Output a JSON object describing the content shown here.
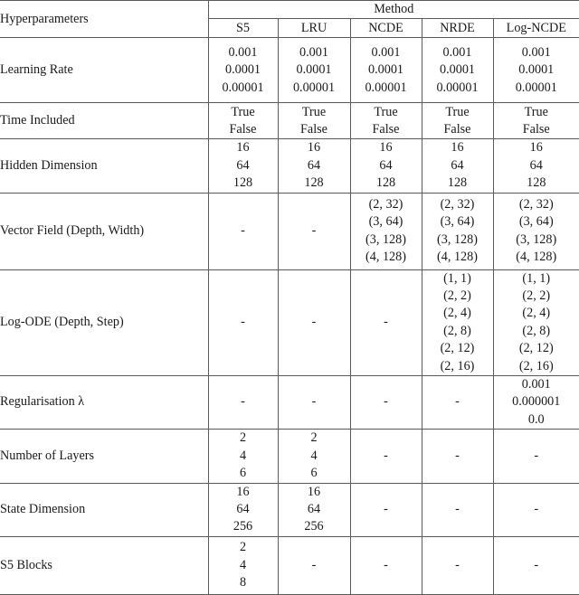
{
  "table": {
    "corner_label": "Hyperparameters",
    "group_header": "Method",
    "columns": [
      "S5",
      "LRU",
      "NCDE",
      "NRDE",
      "Log-NCDE"
    ],
    "dash": "-",
    "rows": [
      {
        "label": "Learning Rate",
        "cells": [
          [
            "0.001",
            "0.0001",
            "0.00001"
          ],
          [
            "0.001",
            "0.0001",
            "0.00001"
          ],
          [
            "0.001",
            "0.0001",
            "0.00001"
          ],
          [
            "0.001",
            "0.0001",
            "0.00001"
          ],
          [
            "0.001",
            "0.0001",
            "0.00001"
          ]
        ]
      },
      {
        "label": "Time Included",
        "cells": [
          [
            "True",
            "False"
          ],
          [
            "True",
            "False"
          ],
          [
            "True",
            "False"
          ],
          [
            "True",
            "False"
          ],
          [
            "True",
            "False"
          ]
        ]
      },
      {
        "label": "Hidden Dimension",
        "cells": [
          [
            "16",
            "64",
            "128"
          ],
          [
            "16",
            "64",
            "128"
          ],
          [
            "16",
            "64",
            "128"
          ],
          [
            "16",
            "64",
            "128"
          ],
          [
            "16",
            "64",
            "128"
          ]
        ]
      },
      {
        "label": "Vector Field (Depth, Width)",
        "cells": [
          [
            "-"
          ],
          [
            "-"
          ],
          [
            "(2, 32)",
            "(3, 64)",
            "(3, 128)",
            "(4, 128)"
          ],
          [
            "(2, 32)",
            "(3, 64)",
            "(3, 128)",
            "(4, 128)"
          ],
          [
            "(2, 32)",
            "(3, 64)",
            "(3, 128)",
            "(4, 128)"
          ]
        ]
      },
      {
        "label": "Log-ODE (Depth, Step)",
        "cells": [
          [
            "-"
          ],
          [
            "-"
          ],
          [
            "-"
          ],
          [
            "(1, 1)",
            "(2, 2)",
            "(2, 4)",
            "(2, 8)",
            "(2, 12)",
            "(2, 16)"
          ],
          [
            "(1, 1)",
            "(2, 2)",
            "(2, 4)",
            "(2, 8)",
            "(2, 12)",
            "(2, 16)"
          ]
        ]
      },
      {
        "label": "Regularisation λ",
        "cells": [
          [
            "-"
          ],
          [
            "-"
          ],
          [
            "-"
          ],
          [
            "-"
          ],
          [
            "0.001",
            "0.000001",
            "0.0"
          ]
        ]
      },
      {
        "label": "Number of Layers",
        "cells": [
          [
            "2",
            "4",
            "6"
          ],
          [
            "2",
            "4",
            "6"
          ],
          [
            "-"
          ],
          [
            "-"
          ],
          [
            "-"
          ]
        ]
      },
      {
        "label": "State Dimension",
        "cells": [
          [
            "16",
            "64",
            "256"
          ],
          [
            "16",
            "64",
            "256"
          ],
          [
            "-"
          ],
          [
            "-"
          ],
          [
            "-"
          ]
        ]
      },
      {
        "label": "S5 Blocks",
        "cells": [
          [
            "2",
            "4",
            "8"
          ],
          [
            "-"
          ],
          [
            "-"
          ],
          [
            "-"
          ],
          [
            "-"
          ]
        ]
      }
    ]
  }
}
